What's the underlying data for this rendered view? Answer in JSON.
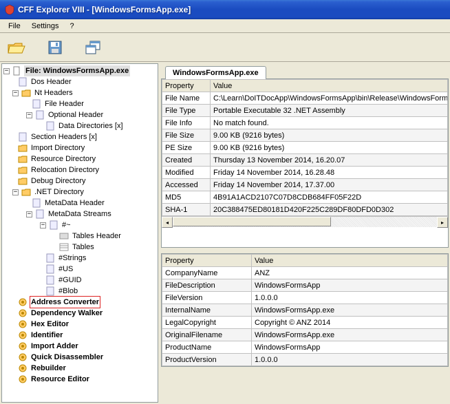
{
  "window": {
    "title": "CFF Explorer VIII - [WindowsFormsApp.exe]"
  },
  "menu": {
    "file": "File",
    "settings": "Settings",
    "help": "?"
  },
  "tab": {
    "label": "WindowsFormsApp.exe"
  },
  "tree": {
    "root": "File: WindowsFormsApp.exe",
    "dos_header": "Dos Header",
    "nt_headers": "Nt Headers",
    "file_header": "File Header",
    "optional_header": "Optional Header",
    "data_directories": "Data Directories [x]",
    "section_headers": "Section Headers [x]",
    "import_directory": "Import Directory",
    "resource_directory": "Resource Directory",
    "relocation_directory": "Relocation Directory",
    "debug_directory": "Debug Directory",
    "net_directory": ".NET Directory",
    "metadata_header": "MetaData Header",
    "metadata_streams": "MetaData Streams",
    "stream_main": "#~",
    "tables_header": "Tables Header",
    "tables": "Tables",
    "strings": "#Strings",
    "us": "#US",
    "guid": "#GUID",
    "blob": "#Blob",
    "address_converter": "Address Converter",
    "dependency_walker": "Dependency Walker",
    "hex_editor": "Hex Editor",
    "identifier": "Identifier",
    "import_adder": "Import Adder",
    "quick_disassembler": "Quick Disassembler",
    "rebuilder": "Rebuilder",
    "resource_editor": "Resource Editor"
  },
  "grid_top": {
    "headers": {
      "property": "Property",
      "value": "Value"
    },
    "rows": [
      {
        "p": "File Name",
        "v": "C:\\Learn\\DoITDocApp\\WindowsFormsApp\\bin\\Release\\WindowsFormsAp"
      },
      {
        "p": "File Type",
        "v": "Portable Executable 32 .NET Assembly"
      },
      {
        "p": "File Info",
        "v": "No match found."
      },
      {
        "p": "File Size",
        "v": "9.00 KB (9216 bytes)"
      },
      {
        "p": "PE Size",
        "v": "9.00 KB (9216 bytes)"
      },
      {
        "p": "Created",
        "v": "Thursday 13 November 2014, 16.20.07"
      },
      {
        "p": "Modified",
        "v": "Friday 14 November 2014, 16.28.48"
      },
      {
        "p": "Accessed",
        "v": "Friday 14 November 2014, 17.37.00"
      },
      {
        "p": "MD5",
        "v": "4B91A1ACD2107C07D8CDB684FF05F22D"
      },
      {
        "p": "SHA-1",
        "v": "20C388475ED80181D420F225C289DF80DFD0D302"
      }
    ]
  },
  "grid_bottom": {
    "headers": {
      "property": "Property",
      "value": "Value"
    },
    "rows": [
      {
        "p": "CompanyName",
        "v": "ANZ"
      },
      {
        "p": "FileDescription",
        "v": "WindowsFormsApp"
      },
      {
        "p": "FileVersion",
        "v": "1.0.0.0"
      },
      {
        "p": "InternalName",
        "v": "WindowsFormsApp.exe"
      },
      {
        "p": "LegalCopyright",
        "v": "Copyright © ANZ 2014"
      },
      {
        "p": "OriginalFilename",
        "v": "WindowsFormsApp.exe"
      },
      {
        "p": "ProductName",
        "v": "WindowsFormsApp"
      },
      {
        "p": "ProductVersion",
        "v": "1.0.0.0"
      }
    ]
  }
}
